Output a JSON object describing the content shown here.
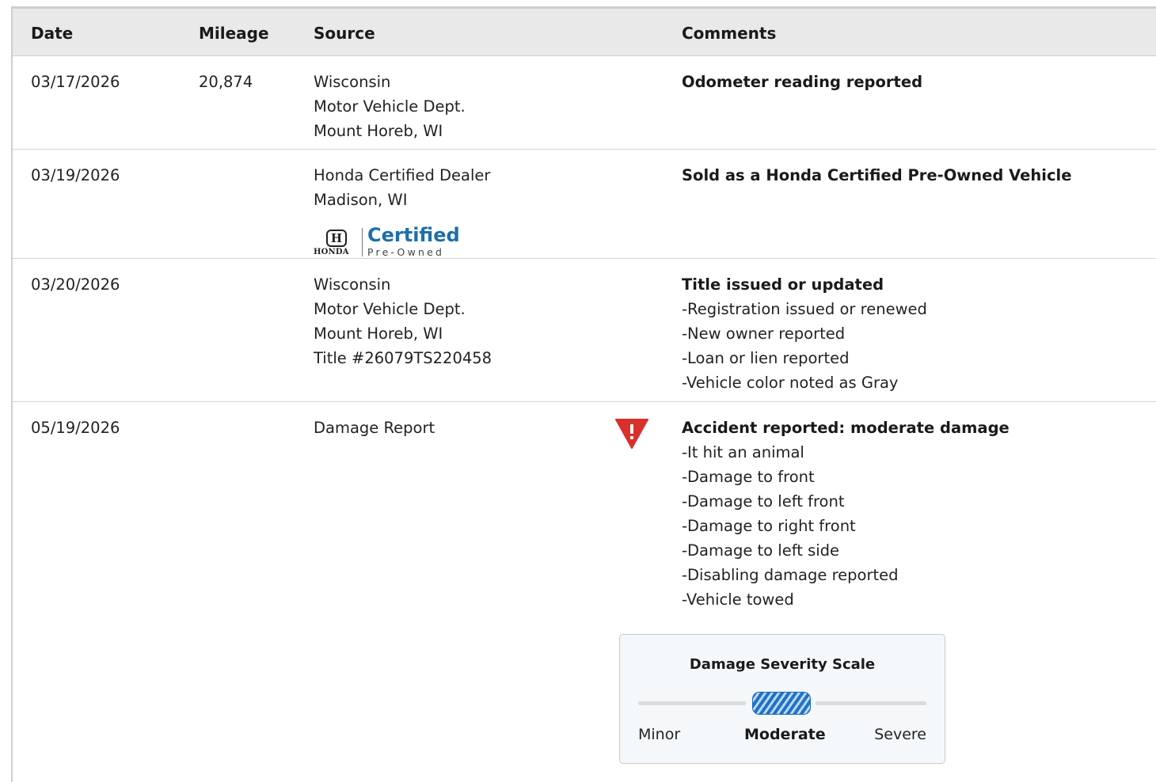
{
  "headers": {
    "date": "Date",
    "mileage": "Mileage",
    "source": "Source",
    "comments": "Comments"
  },
  "rows": [
    {
      "date": "03/17/2026",
      "mileage": "20,874",
      "source": [
        "Wisconsin",
        "Motor Vehicle Dept.",
        "Mount Horeb, WI"
      ],
      "comment_title": "Odometer reading reported",
      "comment_items": []
    },
    {
      "date": "03/19/2026",
      "mileage": "",
      "source": [
        "Honda Certified Dealer",
        "Madison, WI"
      ],
      "badge": {
        "brand": "HONDA",
        "certified": "Certified",
        "pre_owned": "Pre-Owned"
      },
      "comment_title": "Sold as a Honda Certified Pre-Owned Vehicle",
      "comment_items": []
    },
    {
      "date": "03/20/2026",
      "mileage": "",
      "source": [
        "Wisconsin",
        "Motor Vehicle Dept.",
        "Mount Horeb, WI",
        "Title #26079TS220458"
      ],
      "comment_title": "Title issued or updated",
      "comment_items": [
        "-Registration issued or renewed",
        "-New owner reported",
        "-Loan or lien reported",
        "-Vehicle color noted as Gray"
      ]
    },
    {
      "date": "05/19/2026",
      "mileage": "",
      "source": [
        "Damage Report"
      ],
      "icon": "warning-triangle-icon",
      "comment_title": "Accident reported: moderate damage",
      "comment_items": [
        "-It hit an animal",
        "-Damage to front",
        "-Damage to left front",
        "-Damage to right front",
        "-Damage to left side",
        "-Disabling damage reported",
        "-Vehicle towed"
      ]
    }
  ],
  "damage_scale": {
    "title": "Damage Severity Scale",
    "levels": [
      "Minor",
      "Moderate",
      "Severe"
    ],
    "selected": "Moderate"
  },
  "colors": {
    "header_bg": "#e9e9e9",
    "warning_red": "#d9302c",
    "certified_blue": "#1d6fa8",
    "scale_blue": "#1f72c7"
  }
}
